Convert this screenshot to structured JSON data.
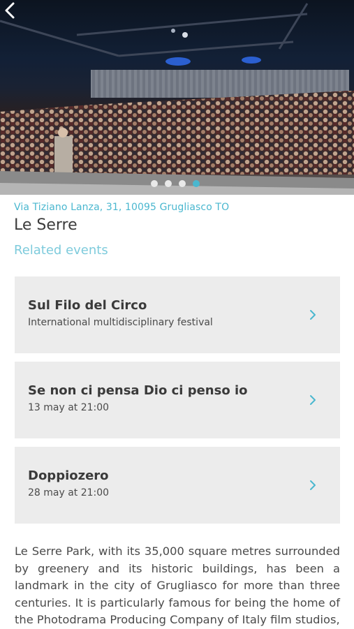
{
  "hero": {
    "image": "theatre-audience-photo",
    "slide_count": 4,
    "active_slide": 4
  },
  "venue": {
    "address": "Via Tiziano Lanza, 31, 10095 Grugliasco TO",
    "name": "Le Serre"
  },
  "related": {
    "heading": "Related events",
    "events": [
      {
        "title": "Sul Filo del Circo",
        "subtitle": "International multidisciplinary festival"
      },
      {
        "title": "Se non ci pensa Dio ci penso io",
        "subtitle": "13 may at 21:00"
      },
      {
        "title": "Doppiozero",
        "subtitle": "28 may at 21:00"
      }
    ]
  },
  "description": "Le Serre Park, with its 35,000 square metres surrounded by greenery and its historic buildings, has been a landmark in the city of Grugliasco for more than three centuries. It is particularly famous for being the home of the Photodrama Producing Company of Italy film studios,",
  "colors": {
    "accent": "#4ab7cf",
    "card_bg": "#ececec",
    "text": "#3c3c3c"
  },
  "icons": {
    "back": "back-arrow-icon",
    "chevron": "chevron-right-icon"
  }
}
